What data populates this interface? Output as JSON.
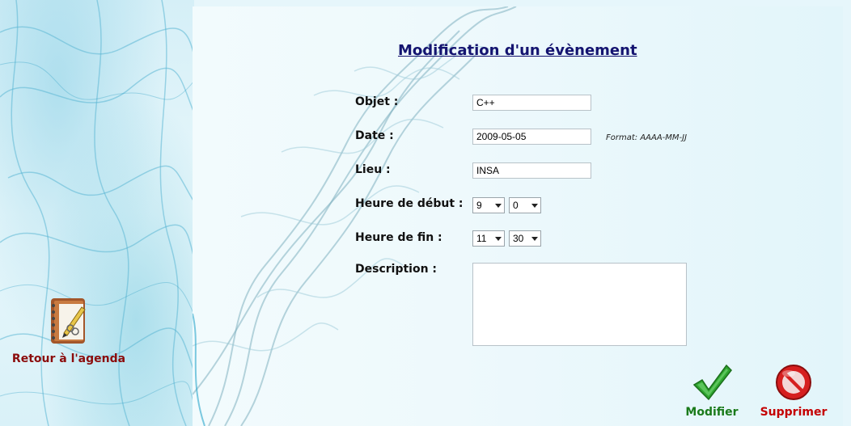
{
  "page": {
    "title": "Modification d'un évènement"
  },
  "form": {
    "objet": {
      "label": "Objet :",
      "value": "C++"
    },
    "date": {
      "label": "Date :",
      "value": "2009-05-05",
      "hint": "Format: AAAA-MM-JJ"
    },
    "lieu": {
      "label": "Lieu :",
      "value": "INSA"
    },
    "heure_debut": {
      "label": "Heure de début :",
      "hour": "9",
      "minute": "0"
    },
    "heure_fin": {
      "label": "Heure de fin :",
      "hour": "11",
      "minute": "30"
    },
    "description": {
      "label": "Description :",
      "value": ""
    }
  },
  "nav": {
    "back_label": "Retour à l'agenda",
    "back_icon": "agenda-notebook-icon"
  },
  "actions": {
    "modify_label": "Modifier",
    "modify_icon": "green-checkmark-icon",
    "modify_color": "#1a7a1a",
    "delete_label": "Supprimer",
    "delete_icon": "red-forbidden-icon",
    "delete_color": "#c40000"
  },
  "colors": {
    "title": "#141470",
    "back_link": "#8b0c0c"
  }
}
